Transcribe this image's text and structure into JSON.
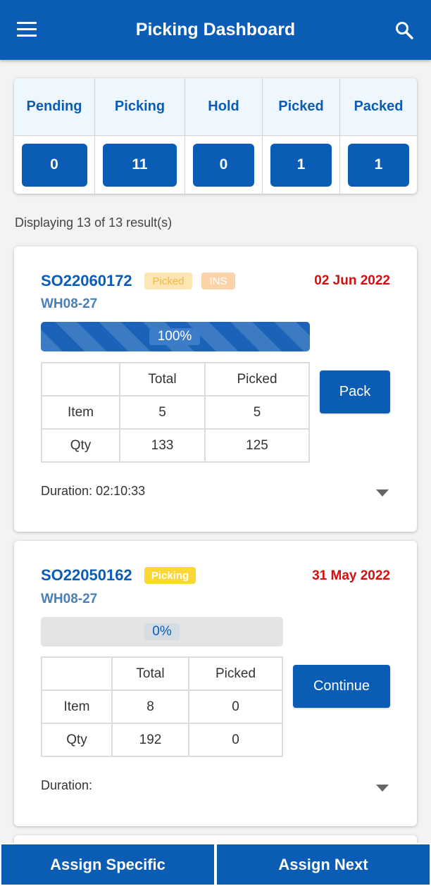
{
  "header": {
    "title": "Picking Dashboard",
    "menu_icon": "menu-icon",
    "search_icon": "search-icon",
    "color": "#0b5cb5"
  },
  "summary": {
    "columns": [
      {
        "label": "Pending",
        "count": "0"
      },
      {
        "label": "Picking",
        "count": "11"
      },
      {
        "label": "Hold",
        "count": "0"
      },
      {
        "label": "Picked",
        "count": "1"
      },
      {
        "label": "Packed",
        "count": "1"
      }
    ]
  },
  "results_text": "Displaying 13 of 13 result(s)",
  "orders": [
    {
      "order_no": "SO22060172",
      "status_badge": "Picked",
      "extra_badge": "INS",
      "date": "02 Jun 2022",
      "location": "WH08-27",
      "progress_percent": 100,
      "progress_label": "100%",
      "table": {
        "headers": [
          "",
          "Total",
          "Picked"
        ],
        "rows": [
          {
            "label": "Item",
            "total": "5",
            "picked": "5"
          },
          {
            "label": "Qty",
            "total": "133",
            "picked": "125"
          }
        ]
      },
      "action": "Pack",
      "duration_label": "Duration:",
      "duration_value": "02:10:33"
    },
    {
      "order_no": "SO22050162",
      "status_badge": "Picking",
      "date": "31 May 2022",
      "location": "WH08-27",
      "progress_percent": 0,
      "progress_label": "0%",
      "table": {
        "headers": [
          "",
          "Total",
          "Picked"
        ],
        "rows": [
          {
            "label": "Item",
            "total": "8",
            "picked": "0"
          },
          {
            "label": "Qty",
            "total": "192",
            "picked": "0"
          }
        ]
      },
      "action": "Continue",
      "duration_label": "Duration:",
      "duration_value": ""
    }
  ],
  "bottom_bar": {
    "assign_specific": "Assign Specific",
    "assign_next": "Assign Next"
  },
  "colors": {
    "primary": "#0b5cb5",
    "date_red": "#d50f0f",
    "picked_badge": "#fde5b4",
    "picking_badge": "#fcd633",
    "ins_badge": "#fcd2a9"
  }
}
